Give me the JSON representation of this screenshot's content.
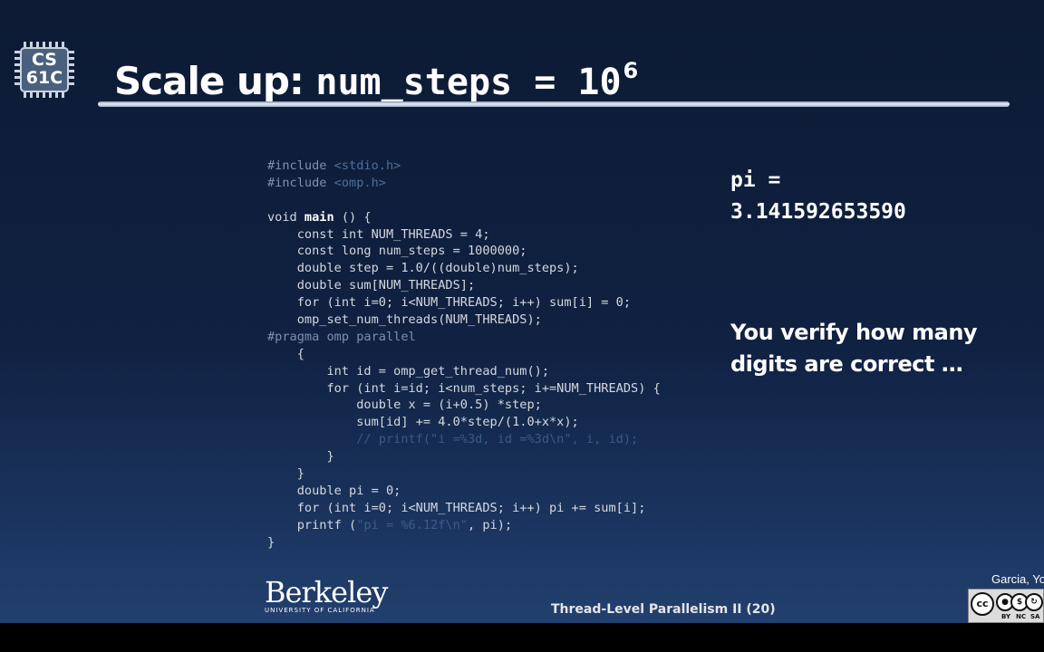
{
  "logo": {
    "line1": "CS",
    "line2": "61C"
  },
  "title": {
    "text": "Scale up: ",
    "code": "num_steps = 10",
    "exponent": "6"
  },
  "code": [
    [
      {
        "t": "#include ",
        "c": "pre"
      },
      {
        "t": "<stdio.h>",
        "c": "hdr"
      }
    ],
    [
      {
        "t": "#include ",
        "c": "pre"
      },
      {
        "t": "<omp.h>",
        "c": "hdr"
      }
    ],
    [
      {
        "t": "",
        "c": ""
      }
    ],
    [
      {
        "t": "void ",
        "c": ""
      },
      {
        "t": "main",
        "c": "bold"
      },
      {
        "t": " () {",
        "c": ""
      }
    ],
    [
      {
        "t": "    const int NUM_THREADS = 4;",
        "c": ""
      }
    ],
    [
      {
        "t": "    const long num_steps = 1000000;",
        "c": ""
      }
    ],
    [
      {
        "t": "    double step = 1.0/((double)num_steps);",
        "c": ""
      }
    ],
    [
      {
        "t": "    double sum[NUM_THREADS];",
        "c": ""
      }
    ],
    [
      {
        "t": "    for (int i=0; i<NUM_THREADS; i++) sum[i] = 0;",
        "c": ""
      }
    ],
    [
      {
        "t": "    omp_set_num_threads(NUM_THREADS);",
        "c": ""
      }
    ],
    [
      {
        "t": "#pragma omp parallel",
        "c": "pre"
      }
    ],
    [
      {
        "t": "    {",
        "c": ""
      }
    ],
    [
      {
        "t": "        int id = omp_get_thread_num();",
        "c": ""
      }
    ],
    [
      {
        "t": "        for (int i=id; i<num_steps; i+=NUM_THREADS) {",
        "c": ""
      }
    ],
    [
      {
        "t": "            double x = (i+0.5) *step;",
        "c": ""
      }
    ],
    [
      {
        "t": "            sum[id] += 4.0*step/(1.0+x*x);",
        "c": ""
      }
    ],
    [
      {
        "t": "            // printf(\"i =%3d, id =%3d\\n\", i, id);",
        "c": "com"
      }
    ],
    [
      {
        "t": "        }",
        "c": ""
      }
    ],
    [
      {
        "t": "    }",
        "c": ""
      }
    ],
    [
      {
        "t": "    double pi = 0;",
        "c": ""
      }
    ],
    [
      {
        "t": "    for (int i=0; i<NUM_THREADS; i++) pi += sum[i];",
        "c": ""
      }
    ],
    [
      {
        "t": "    printf (",
        "c": ""
      },
      {
        "t": "\"pi = %6.12f\\n\"",
        "c": "str"
      },
      {
        "t": ", pi);",
        "c": ""
      }
    ],
    [
      {
        "t": "}",
        "c": ""
      }
    ]
  ],
  "result": {
    "label": "pi =",
    "value": "3.141592653590"
  },
  "note": "You verify how many digits are correct …",
  "footer": {
    "university": "Berkeley",
    "university_sub": "UNIVERSITY OF CALIFORNIA",
    "lecture_title": "Thread-Level Parallelism II",
    "slide_number": "(20)",
    "author": "Garcia, Yo"
  },
  "license": {
    "cc": "cc",
    "by": "BY",
    "nc": "NC",
    "sa": "SA"
  }
}
